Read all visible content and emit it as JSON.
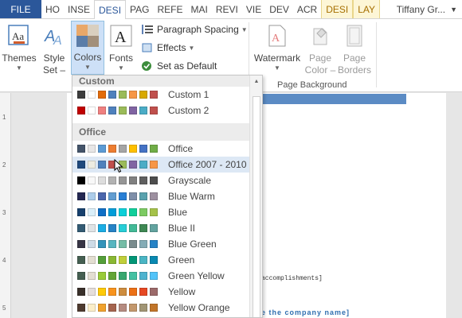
{
  "tabs": [
    "FILE",
    "HO",
    "INSE",
    "DESI",
    "PAG",
    "REFE",
    "MAI",
    "REVI",
    "VIE",
    "DEV",
    "ACR",
    "DESI",
    "LAY"
  ],
  "user": "Tiffany Gr...",
  "ribbon": {
    "themes": "Themes",
    "style_set": [
      "Style",
      "Set –"
    ],
    "colors": "Colors",
    "fonts": "Fonts",
    "paragraph_spacing": "Paragraph Spacing",
    "effects": "Effects",
    "set_as_default": "Set as Default",
    "watermark": "Watermark",
    "page_color": [
      "Page",
      "Color –"
    ],
    "page_borders": [
      "Page",
      "Borders"
    ],
    "page_background": "Page Background"
  },
  "ruler_ticks": [
    "1",
    "2",
    "3",
    "4",
    "5"
  ],
  "document": {
    "line1": "accomplishments]",
    "line2": "e the company name]"
  },
  "dropdown": {
    "custom_header": "Custom",
    "office_header": "Office",
    "custom": [
      {
        "name": "Custom 1",
        "swatches": [
          "#3d3d3d",
          "#ffffff",
          "#e36c0a",
          "#4f81bd",
          "#9bbb59",
          "#f79646",
          "#d8a900",
          "#c0504d"
        ]
      },
      {
        "name": "Custom 2",
        "swatches": [
          "#c00000",
          "#ffffff",
          "#f08080",
          "#4f81bd",
          "#9bbb59",
          "#8064a2",
          "#4bacc6",
          "#c0504d"
        ]
      }
    ],
    "office": [
      {
        "name": "Office",
        "swatches": [
          "#44546a",
          "#e7e6e6",
          "#5b9bd5",
          "#ed7d31",
          "#a5a5a5",
          "#ffc000",
          "#4472c4",
          "#70ad47"
        ]
      },
      {
        "name": "Office 2007 - 2010",
        "swatches": [
          "#1f497d",
          "#eeece1",
          "#4f81bd",
          "#c0504d",
          "#9bbb59",
          "#8064a2",
          "#4bacc6",
          "#f79646"
        ]
      },
      {
        "name": "Grayscale",
        "swatches": [
          "#000000",
          "#f8f8f8",
          "#dddddd",
          "#b2b2b2",
          "#969696",
          "#808080",
          "#5f5f5f",
          "#4d4d4d"
        ]
      },
      {
        "name": "Blue Warm",
        "swatches": [
          "#242852",
          "#acccea",
          "#4a66ac",
          "#629dd1",
          "#297fd5",
          "#7f8fa9",
          "#5aa2ae",
          "#9d90a0"
        ]
      },
      {
        "name": "Blue",
        "swatches": [
          "#17406d",
          "#dbeff9",
          "#0f6fc6",
          "#009dd9",
          "#0bd0d9",
          "#10cf9b",
          "#7cca62",
          "#a5c249"
        ]
      },
      {
        "name": "Blue II",
        "swatches": [
          "#335b74",
          "#dfe3e5",
          "#1cade4",
          "#2683c6",
          "#27ced7",
          "#42ba97",
          "#3e8853",
          "#62a39f"
        ]
      },
      {
        "name": "Blue Green",
        "swatches": [
          "#373545",
          "#cedbe6",
          "#3494ba",
          "#58b6c0",
          "#75bda7",
          "#7a8c8e",
          "#84acb6",
          "#2683c6"
        ]
      },
      {
        "name": "Green",
        "swatches": [
          "#455f51",
          "#e3ded1",
          "#549e39",
          "#8ab833",
          "#c0cf3a",
          "#029676",
          "#4ab5c4",
          "#0989b1"
        ]
      },
      {
        "name": "Green Yellow",
        "swatches": [
          "#455f51",
          "#e3ded1",
          "#99cb38",
          "#63a537",
          "#37a76f",
          "#44c1a3",
          "#4eb3cf",
          "#51c3f9"
        ]
      },
      {
        "name": "Yellow",
        "swatches": [
          "#39302a",
          "#e5dedb",
          "#ffca08",
          "#f8931d",
          "#ce8d3e",
          "#ec7016",
          "#e64823",
          "#9c6a6a"
        ]
      },
      {
        "name": "Yellow Orange",
        "swatches": [
          "#4e3b30",
          "#fbeec9",
          "#f0a22e",
          "#a5644e",
          "#b58b80",
          "#c3986d",
          "#a19574",
          "#c17529"
        ]
      }
    ]
  }
}
